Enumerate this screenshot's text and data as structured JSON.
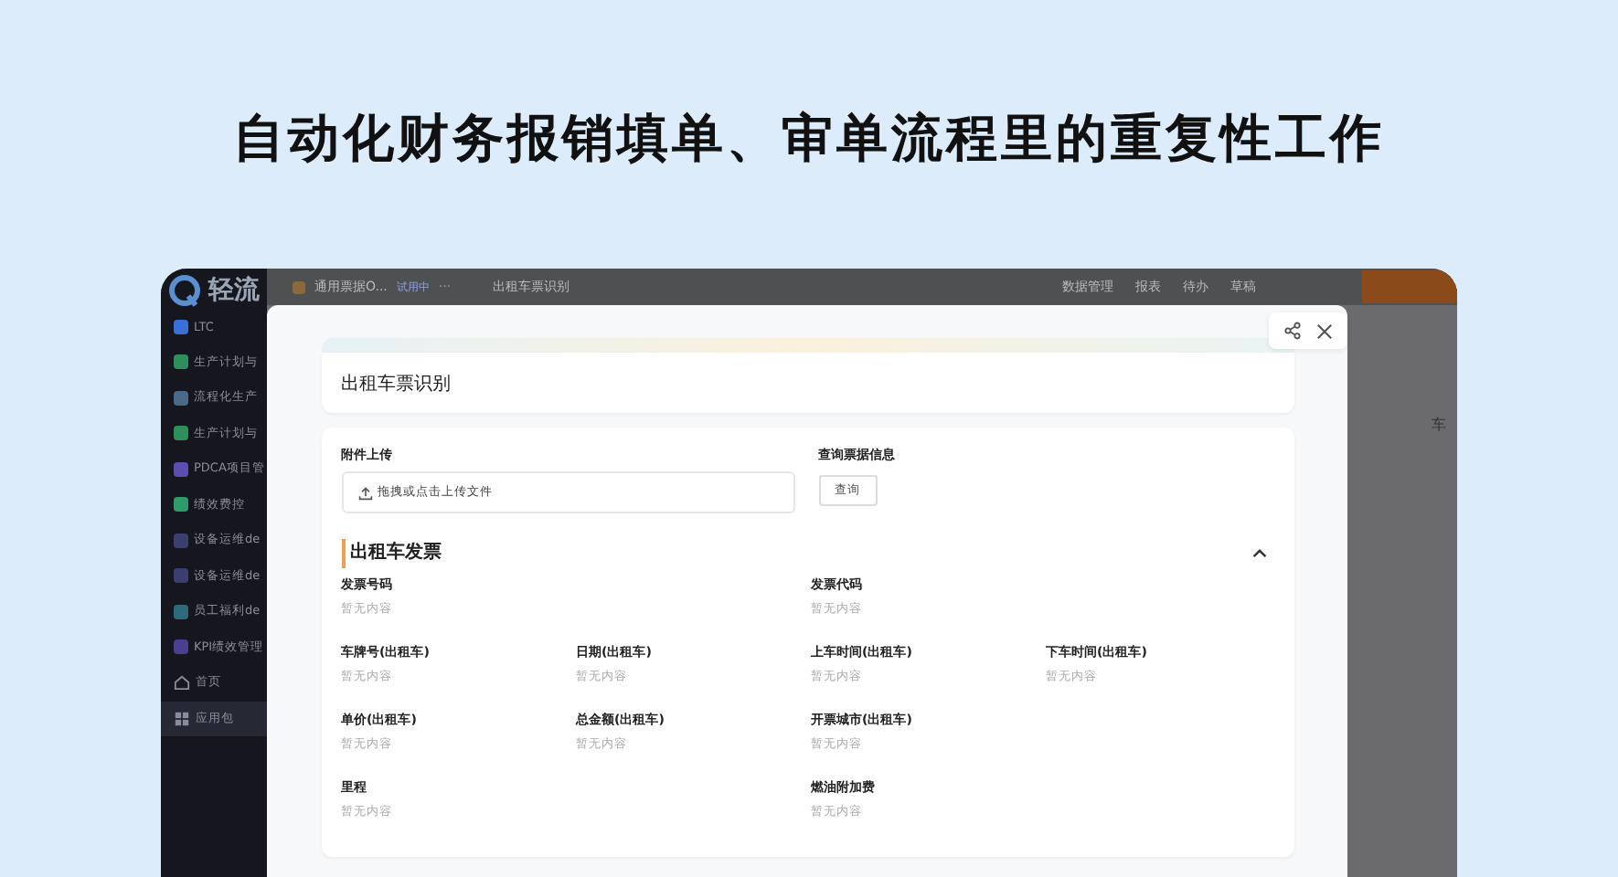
{
  "headline": "自动化财务报销填单、审单流程里的重复性工作",
  "app": {
    "logo": "轻流",
    "sidebar": [
      {
        "label": "LTC",
        "color": "#3a6fd8",
        "selected": false
      },
      {
        "label": "生产计划与",
        "color": "#2f8f5a",
        "selected": false
      },
      {
        "label": "流程化生产",
        "color": "#4a6a8a",
        "selected": false
      },
      {
        "label": "生产计划与",
        "color": "#2f8f5a",
        "selected": false
      },
      {
        "label": "PDCA项目管",
        "color": "#5a4fb0",
        "selected": false
      },
      {
        "label": "绩效费控",
        "color": "#2f9a6a",
        "selected": false
      },
      {
        "label": "设备运维de",
        "color": "#3a3f70",
        "selected": false
      },
      {
        "label": "设备运维de",
        "color": "#3a3f70",
        "selected": false
      },
      {
        "label": "员工福利de",
        "color": "#2f6a7a",
        "selected": false
      },
      {
        "label": "KPI绩效管理",
        "color": "#4a3f90",
        "selected": false
      },
      {
        "label": "首页",
        "kind": "home",
        "selected": false
      },
      {
        "label": "应用包",
        "kind": "apps",
        "selected": true
      }
    ],
    "tabs": [
      {
        "label": "通用票据O...",
        "badge": "试用中",
        "more": "···"
      },
      {
        "label": "出租车票识别"
      }
    ],
    "toolbar": [
      "数据管理",
      "报表",
      "待办",
      "草稿"
    ],
    "behind_text": "车"
  },
  "modal": {
    "title": "出租车票识别",
    "upload": {
      "label": "附件上传",
      "placeholder": "拖拽或点击上传文件"
    },
    "query": {
      "label": "查询票据信息",
      "button": "查询"
    },
    "section": {
      "title": "出租车发票",
      "expanded": true,
      "rows": [
        [
          {
            "label": "发票号码",
            "value": "暂无内容",
            "wide": true
          },
          {
            "label": "发票代码",
            "value": "暂无内容",
            "wide": true
          }
        ],
        [
          {
            "label": "车牌号(出租车)",
            "value": "暂无内容",
            "wide": false
          },
          {
            "label": "日期(出租车)",
            "value": "暂无内容",
            "wide": false
          },
          {
            "label": "上车时间(出租车)",
            "value": "暂无内容",
            "wide": false
          },
          {
            "label": "下车时间(出租车)",
            "value": "暂无内容",
            "wide": false
          }
        ],
        [
          {
            "label": "单价(出租车)",
            "value": "暂无内容",
            "wide": false
          },
          {
            "label": "总金额(出租车)",
            "value": "暂无内容",
            "wide": false
          },
          {
            "label": "开票城市(出租车)",
            "value": "暂无内容",
            "wide": true
          }
        ],
        [
          {
            "label": "里程",
            "value": "暂无内容",
            "wide": true
          },
          {
            "label": "燃油附加费",
            "value": "暂无内容",
            "wide": true
          }
        ]
      ]
    }
  }
}
